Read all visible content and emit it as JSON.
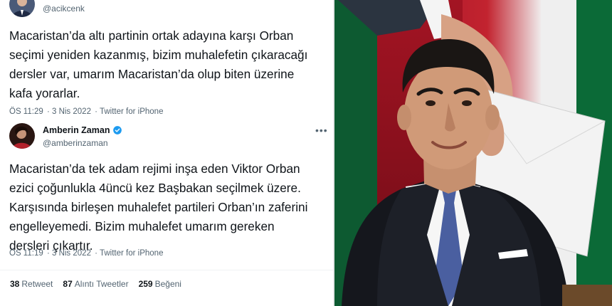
{
  "tweet1": {
    "handle": "@acikcenk",
    "text": "Macaristan’da altı partinin ortak adayına karşı Orban\nseçimi yeniden kazanmış, bizim muhalefetin çıkaracağı\ndersler var, umarım Macaristan’da olup biten üzerine\nkafa yorarlar.",
    "time": "ÖS 11:29",
    "date": "3 Nis 2022",
    "source": "Twitter for iPhone"
  },
  "tweet2": {
    "name": "Amberin Zaman",
    "handle": "@amberinzaman",
    "more_icon": "more-dots-icon",
    "text": "Macaristan’da tek adam rejimi inşa eden Viktor Orban\nezici çoğunlukla 4üncü kez Başbakan seçilmek üzere.\nKarşısında birleşen muhalefet partileri Orban’ın zaferini\nengelleyemedi. Bizim muhalefet umarım gereken\ndersleri çıkartır.",
    "time": "ÖS 11:19",
    "date": "3 Nis 2022",
    "source": "Twitter for iPhone"
  },
  "stats": {
    "retweets_count": "38",
    "retweets_label": "Retweet",
    "quotes_count": "87",
    "quotes_label": "Alıntı Tweetler",
    "likes_count": "259",
    "likes_label": "Beğeni"
  },
  "colors": {
    "verified": "#1d9bf0",
    "secondary_text": "#536471",
    "primary_text": "#0f1419"
  }
}
